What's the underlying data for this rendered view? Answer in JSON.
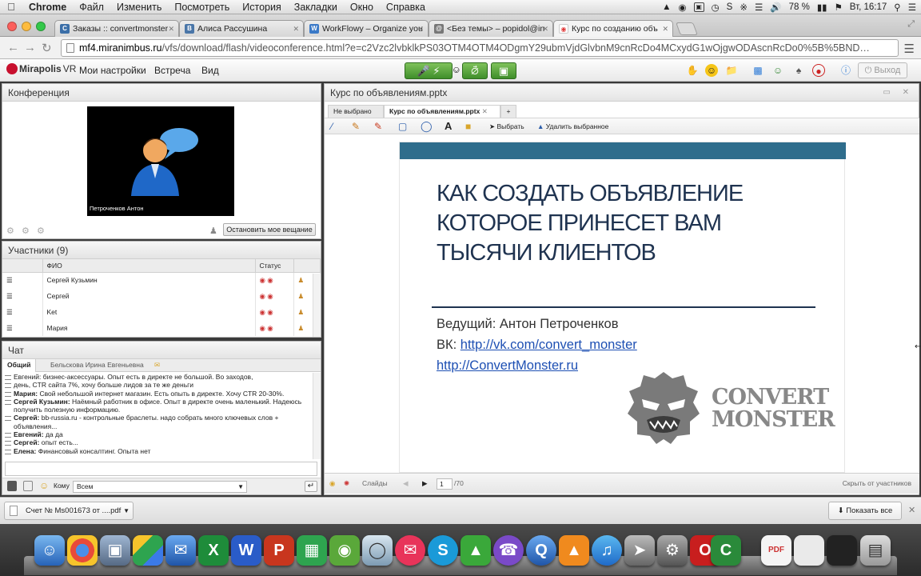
{
  "menubar": {
    "app": "Chrome",
    "items": [
      "Файл",
      "Изменить",
      "Посмотреть",
      "История",
      "Закладки",
      "Окно",
      "Справка"
    ],
    "battery": "78 %",
    "clock": "Вт, 16:17"
  },
  "tabs": [
    {
      "label": "Заказы :: convertmonster",
      "favicon_color": "#3b6fa8",
      "fav": "C"
    },
    {
      "label": "Алиса Рассушина",
      "favicon_color": "#4a76a8",
      "fav": "B"
    },
    {
      "label": "WorkFlowy – Organize you",
      "favicon_color": "#3a79c7",
      "fav": "W"
    },
    {
      "label": "<Без темы> – popidol@in",
      "favicon_color": "#777777",
      "fav": "@"
    },
    {
      "label": "Курс по созданию объ",
      "favicon_color": "#e03a3a",
      "fav": "●"
    }
  ],
  "address": {
    "host": "mf4.miranimbus.ru",
    "path": "/vfs/download/flash/videoconference.html?e=c2Vzc2lvbklkPS03OTM4OTM4ODgmY29ubmVjdGlvbnM9cnRcDo4MCxydG1wOjgwODAscnRcDo0%5B%5BND…"
  },
  "mirapolis": {
    "logo": "Mirapolis",
    "logo_suffix": "VR",
    "menu": [
      "Мои настройки",
      "Встреча",
      "Вид"
    ],
    "exit": "Выход"
  },
  "conference": {
    "title": "Конференция",
    "speaker_name": "Петроченков Антон",
    "stop_button": "Остановить мое вещание"
  },
  "participants": {
    "title": "Участники (9)",
    "col_name": "ФИО",
    "col_status": "Статус",
    "rows": [
      "Сергей Кузьмин",
      "Сергей",
      "Ket",
      "Мария"
    ]
  },
  "chat": {
    "title": "Чат",
    "tab_general": "Общий",
    "tab_private": "Бельскова Ирина  Евгеньевна",
    "messages": [
      {
        "who": "",
        "text": "Евгений: бизнес-аксессуары. Опыт есть в директе не большой. Во заходов,"
      },
      {
        "who": "",
        "text": "день, CTR сайта 7%, хочу больше лидов за те же деньги"
      },
      {
        "who": "Мария:",
        "text": " Свой небольшой интернет магазин. Есть опыть в директе. Хочу CTR 20-30%."
      },
      {
        "who": "Сергей Кузьмин:",
        "text": " Наёмный работник в офисе. Опыт в директе очень маленький. Надеюсь получить полезную информацию."
      },
      {
        "who": "Сергей:",
        "text": " bb-russia.ru - контрольные браслеты. надо собрать много ключевых слов + объявления..."
      },
      {
        "who": "Евгений:",
        "text": " да да"
      },
      {
        "who": "Сергей:",
        "text": " опыт есть..."
      },
      {
        "who": "Елена:",
        "text": " Финансовый консалтинг. Опыта нет"
      }
    ],
    "to_label": "Кому",
    "to_value": "Всем"
  },
  "presentation": {
    "title": "Курс по объявлениям.pptx",
    "tab_none": "Не выбрано",
    "tab_file": "Курс по объявлениям.pptx",
    "tab_plus": "+",
    "tool_select": "Выбрать",
    "tool_delete": "Удалить выбранное",
    "slide": {
      "title_lines": [
        "КАК СОЗДАТЬ ОБЪЯВЛЕНИЕ",
        "КОТОРОЕ ПРИНЕСЕТ ВАМ",
        "ТЫСЯЧИ КЛИЕНТОВ"
      ],
      "host_label": "Ведущий:  Антон Петроченков",
      "vk_label": "ВК:",
      "vk_link": "http://vk.com/convert_monster",
      "site_link": "http://ConvertMonster.ru",
      "brand_line1": "CONVERT",
      "brand_line2": "MONSTER",
      "bar_color": "#2f6d8c"
    },
    "footer_slides": "Слайды",
    "page_current": "1",
    "page_total": "/70",
    "hide_label": "Скрыть от участников"
  },
  "download": {
    "file": "Счет № Ms001673 от ....pdf",
    "show_all": "Показать все"
  }
}
